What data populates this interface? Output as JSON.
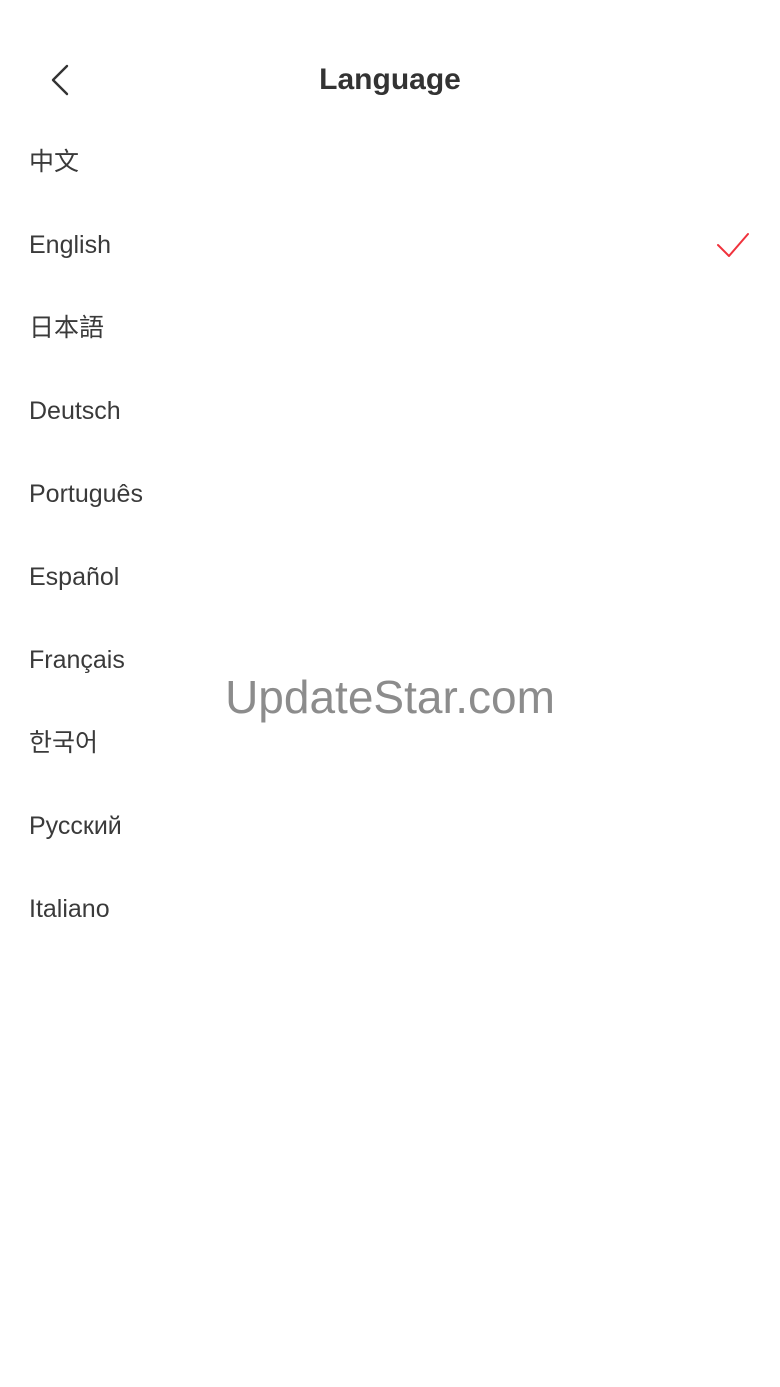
{
  "header": {
    "back_icon": "chevron-left-icon",
    "title": "Language"
  },
  "languages": [
    {
      "label": "中文",
      "selected": false
    },
    {
      "label": "English",
      "selected": true
    },
    {
      "label": "日本語",
      "selected": false
    },
    {
      "label": "Deutsch",
      "selected": false
    },
    {
      "label": "Português",
      "selected": false
    },
    {
      "label": "Español",
      "selected": false
    },
    {
      "label": "Français",
      "selected": false
    },
    {
      "label": "한국어",
      "selected": false
    },
    {
      "label": "Русский",
      "selected": false
    },
    {
      "label": "Italiano",
      "selected": false
    }
  ],
  "selection_icon": "checkmark-icon",
  "accent_color": "#f0323c",
  "watermark": "UpdateStar.com"
}
